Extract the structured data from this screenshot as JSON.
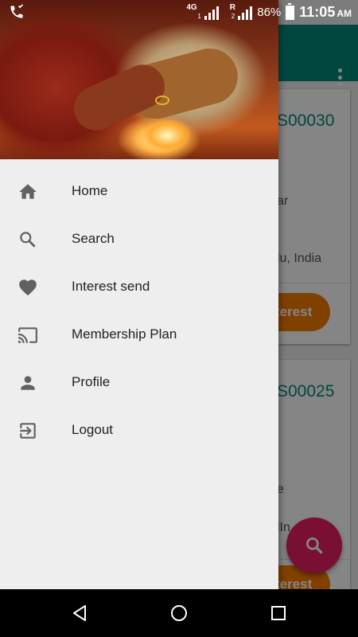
{
  "status_bar": {
    "network_tag": "4G",
    "sim1": "1",
    "sim2": "2",
    "roaming": "R",
    "battery": "86%",
    "time": "11:05",
    "ampm": "AM"
  },
  "drawer": {
    "items": [
      {
        "label": "Home",
        "icon": "home-icon"
      },
      {
        "label": "Search",
        "icon": "search-icon"
      },
      {
        "label": "Interest send",
        "icon": "heart-icon"
      },
      {
        "label": "Membership Plan",
        "icon": "cast-icon"
      },
      {
        "label": "Profile",
        "icon": "person-icon"
      },
      {
        "label": "Logout",
        "icon": "exit-icon"
      }
    ]
  },
  "cards": [
    {
      "id": "S00030",
      "line1": "ar",
      "line2": "lu, India",
      "button": "terest"
    },
    {
      "id": "S00025",
      "line1": "e",
      "line2": "lIn",
      "button": "terest"
    }
  ],
  "colors": {
    "toolbar": "#00897b",
    "accent_button": "#f57c00",
    "fab": "#e91e63"
  }
}
